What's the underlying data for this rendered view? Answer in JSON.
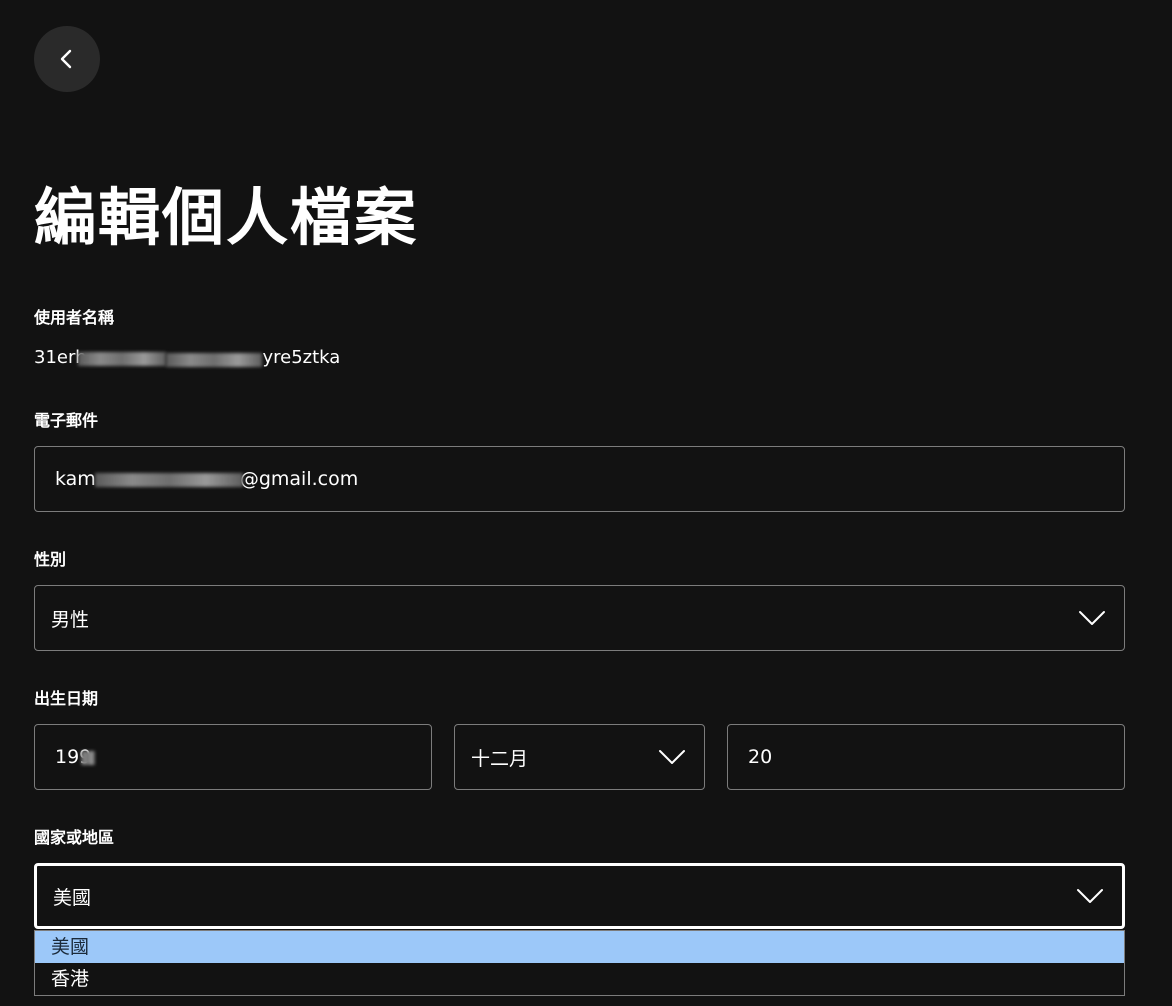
{
  "nav": {
    "back_icon": "chevron-left-icon"
  },
  "page": {
    "title": "編輯個人檔案"
  },
  "username": {
    "label": "使用者名稱",
    "value_start": "31erh",
    "value_end": "yre5ztka"
  },
  "email": {
    "label": "電子郵件",
    "value_start": "kam",
    "value_end": "@gmail.com"
  },
  "gender": {
    "label": "性別",
    "selected": "男性",
    "icon": "chevron-down-icon"
  },
  "birthdate": {
    "label": "出生日期",
    "year": "199",
    "month": "十二月",
    "day": "20",
    "month_icon": "chevron-down-icon"
  },
  "country": {
    "label": "國家或地區",
    "selected": "美國",
    "icon": "chevron-down-icon",
    "options": [
      "美國",
      "香港"
    ],
    "highlighted_option": "美國"
  },
  "colors": {
    "background": "#121212",
    "field_border": "#7c7c7c",
    "focus_border": "#ffffff",
    "option_highlight": "#9cc8f9",
    "button_bg": "#2a2a2a"
  }
}
